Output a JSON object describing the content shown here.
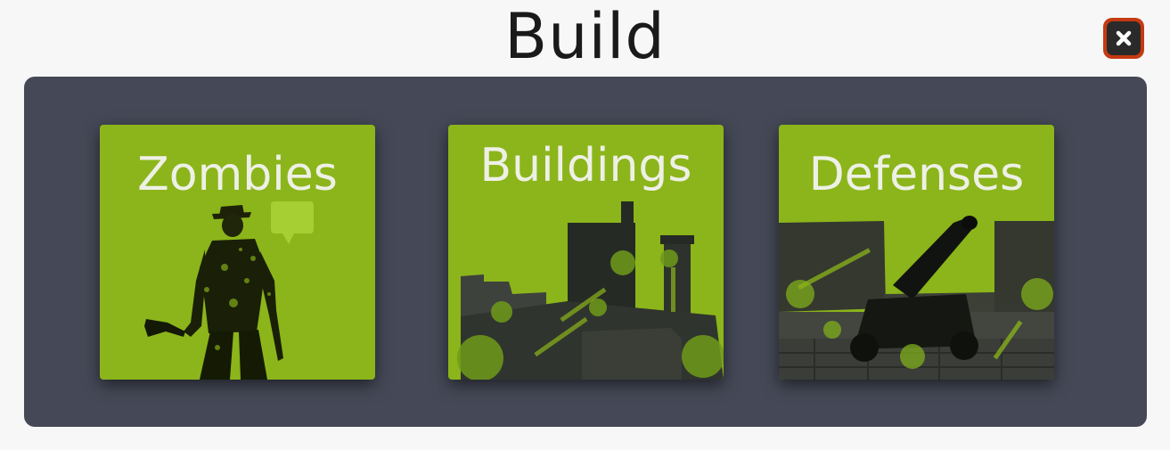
{
  "dialog": {
    "title": "Build",
    "close_icon": "close-x-icon"
  },
  "colors": {
    "card_green": "#8bb51a",
    "panel": "#454957",
    "close_border": "#c53a12"
  },
  "cards": [
    {
      "label": "Zombies",
      "art": "zombie-silhouette"
    },
    {
      "label": "Buildings",
      "art": "factory-silhouette"
    },
    {
      "label": "Defenses",
      "art": "cannon-silhouette"
    }
  ]
}
